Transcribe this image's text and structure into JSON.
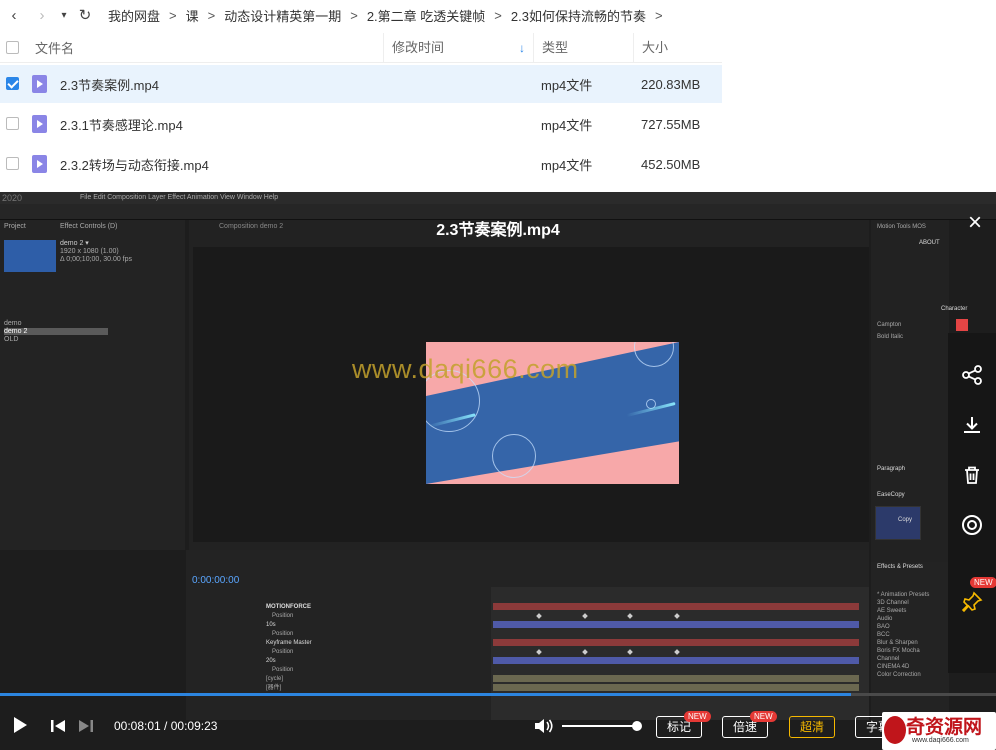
{
  "nav": {
    "back": "‹",
    "forward": "›",
    "dropdown": "▾",
    "refresh": "↻",
    "breadcrumbs": [
      "我的网盘",
      "课",
      "动态设计精英第一期",
      "2.第二章 吃透关键帧",
      "2.3如何保持流畅的节奏"
    ],
    "separator": ">"
  },
  "file_table": {
    "headers": {
      "name": "文件名",
      "time": "修改时间",
      "type": "类型",
      "size": "大小"
    },
    "sort_arrow": "↓",
    "rows": [
      {
        "name": "2.3节奏案例.mp4",
        "type": "mp4文件",
        "size": "220.83MB",
        "selected": true
      },
      {
        "name": "2.3.1节奏感理论.mp4",
        "type": "mp4文件",
        "size": "727.55MB",
        "selected": false
      },
      {
        "name": "2.3.2转场与动态衔接.mp4",
        "type": "mp4文件",
        "size": "452.50MB",
        "selected": false
      }
    ]
  },
  "player": {
    "title": "2.3节奏案例.mp4",
    "close": "×",
    "watermark": "www.daqi666.com",
    "current_time": "00:08:01",
    "total_time": "00:09:23",
    "time_sep": " / ",
    "progress": 0.854,
    "volume": 0.92,
    "buttons": {
      "mark": "标记",
      "speed": "倍速",
      "quality": "超清",
      "subtitle": "字幕"
    },
    "new_badge": "NEW",
    "accent": "#2c85e0",
    "quality_color": "#f5b800"
  },
  "ae": {
    "menu": "File  Edit  Composition  Layer  Effect  Animation  View  Window  Help",
    "app_mark": "2020",
    "project_tab": "Project",
    "effect_controls": "Effect Controls (D)",
    "comp_name": "demo 2 ▾",
    "comp_info": "1920 x 1080 (1.00)",
    "comp_info2": "Δ 0;00;10;00, 30.00 fps",
    "items": [
      "demo",
      "demo 2",
      "OLD"
    ],
    "comp_tab": "Composition demo 2",
    "timecode": "0:00:00:00",
    "layers": [
      "MOTIONFORCE",
      "Position",
      "10s",
      "Position",
      "Keyframe Master",
      "Position",
      "20s",
      "Position",
      "[cycle]",
      "[器件]",
      "[cycle]",
      "[wood.jpg]",
      "[Medium...ue Solid 4]"
    ],
    "effects_title": "Effects & Presets",
    "effects_items": [
      "* Animation Presets",
      "3D Channel",
      "AE Sweets",
      "Audio",
      "BAO",
      "BCC",
      "Blur & Sharpen",
      "Boris FX Mocha",
      "Channel",
      "CINEMA 4D",
      "Color Correction"
    ],
    "character_title": "Character",
    "paragraph_title": "Paragraph",
    "font": "Campton",
    "font_style": "Bold Italic",
    "motion_tools": "Motion Tools MOS",
    "about": "ABOUT",
    "ease_copy": "EaseCopy",
    "copy": "Copy"
  },
  "brand": {
    "name": "奇资源网",
    "url": "www.daqi666.com"
  }
}
